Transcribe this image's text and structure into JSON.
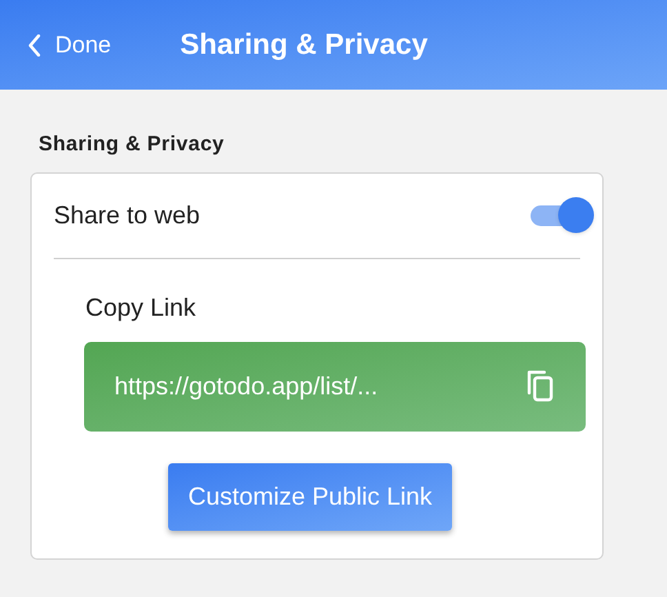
{
  "header": {
    "back_label": "Done",
    "title": "Sharing & Privacy"
  },
  "section": {
    "title": "Sharing & Privacy"
  },
  "share_to_web": {
    "label": "Share to web",
    "on": true
  },
  "copy_link": {
    "label": "Copy Link",
    "url": "https://gotodo.app/list/..."
  },
  "customize_button": {
    "label": "Customize Public Link"
  }
}
